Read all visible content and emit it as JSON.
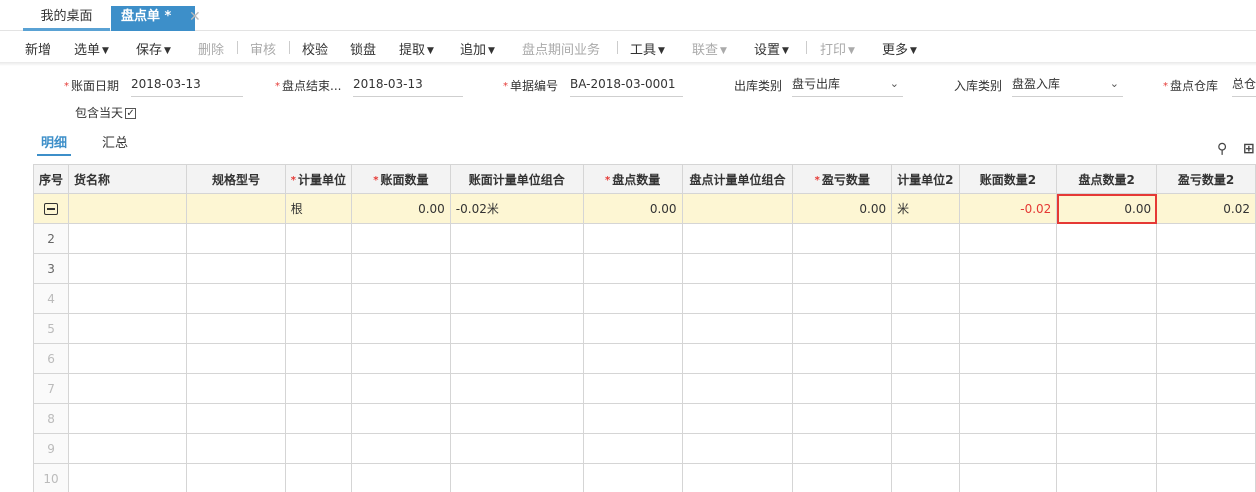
{
  "tabs": [
    {
      "label": "我的桌面"
    },
    {
      "label": "盘点单 *",
      "close": "✕"
    }
  ],
  "toolbar": {
    "add": "新增",
    "select": "选单",
    "save": "保存",
    "delete": "删除",
    "audit": "审核",
    "verify": "校验",
    "lock": "锁盘",
    "fetch": "提取",
    "append": "追加",
    "period": "盘点期间业务",
    "tools": "工具",
    "link": "联查",
    "settings": "设置",
    "print": "打印",
    "more": "更多"
  },
  "form": {
    "account_date": {
      "label": "账面日期",
      "value": "2018-03-13"
    },
    "end_date": {
      "label": "盘点结束...",
      "value": "2018-03-13"
    },
    "doc_no": {
      "label": "单据编号",
      "value": "BA-2018-03-0001"
    },
    "out_type": {
      "label": "出库类别",
      "value": "盘亏出库"
    },
    "in_type": {
      "label": "入库类别",
      "value": "盘盈入库"
    },
    "warehouse": {
      "label": "盘点仓库",
      "value": "总仓"
    },
    "include_today": {
      "label": "包含当天",
      "checked": true
    }
  },
  "subtabs": [
    "明细",
    "汇总"
  ],
  "icons": {
    "location": "location-pin-icon",
    "add": "add-column-icon",
    "row_cfg": "row-settings-icon"
  },
  "table": {
    "headers": [
      "序号",
      "货名称",
      "规格型号",
      "计量单位",
      "账面数量",
      "账面计量单位组合",
      "盘点数量",
      "盘点计量单位组合",
      "盈亏数量",
      "计量单位2",
      "账面数量2",
      "盘点数量2",
      "盈亏数量2"
    ],
    "required": [
      false,
      false,
      false,
      true,
      true,
      false,
      true,
      false,
      true,
      false,
      false,
      false,
      false
    ],
    "row1": {
      "name": "",
      "spec": "",
      "unit": "根",
      "book_qty": "0.00",
      "book_combo": "-0.02米",
      "count_qty": "0.00",
      "count_combo": "",
      "diff_qty": "0.00",
      "unit2": "米",
      "book_qty2": "-0.02",
      "count_qty2": "0.00",
      "diff_qty2": "0.02"
    },
    "row_numbers": [
      "2",
      "3",
      "4",
      "5",
      "6",
      "7",
      "8",
      "9",
      "10"
    ]
  },
  "colors": {
    "accent": "#3d8fc9",
    "required": "#e53935",
    "row_highlight": "#fdf6d3"
  }
}
